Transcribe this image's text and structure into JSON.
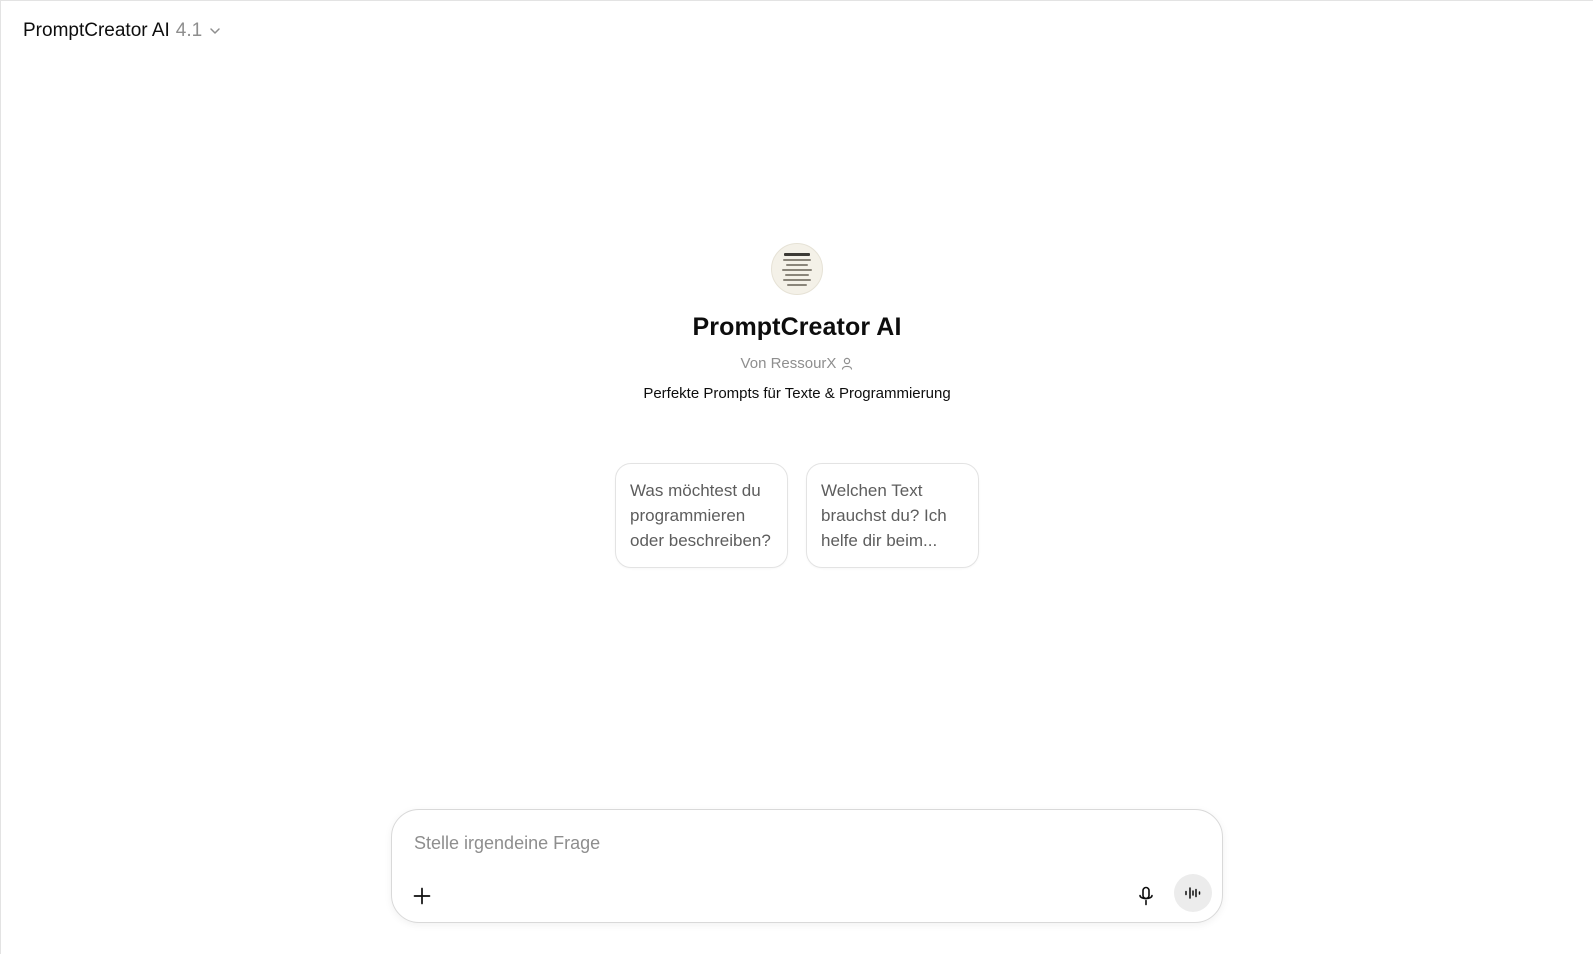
{
  "header": {
    "model_name": "PromptCreator AI",
    "model_version": "4.1",
    "dropdown_icon": "chevron-down-icon"
  },
  "gpt": {
    "avatar_icon": "gpt-avatar",
    "title": "PromptCreator AI",
    "author": "Von RessourX",
    "author_icon": "person-icon",
    "description": "Perfekte Prompts für Texte & Programmierung"
  },
  "starters": [
    {
      "text": "Was möchtest du programmieren oder beschreiben?"
    },
    {
      "text": "Welchen Text brauchst du? Ich helfe dir beim..."
    }
  ],
  "composer": {
    "placeholder": "Stelle irgendeine Frage",
    "value": "",
    "plus_icon": "plus-icon",
    "mic_icon": "microphone-icon",
    "voice_icon": "voice-mode-icon"
  },
  "colors": {
    "text_primary": "#0d0d0d",
    "text_secondary": "#8e8e8e",
    "starter_text": "#5d5d5d",
    "border": "#e3e3e3",
    "voice_button_bg": "#ececec"
  }
}
